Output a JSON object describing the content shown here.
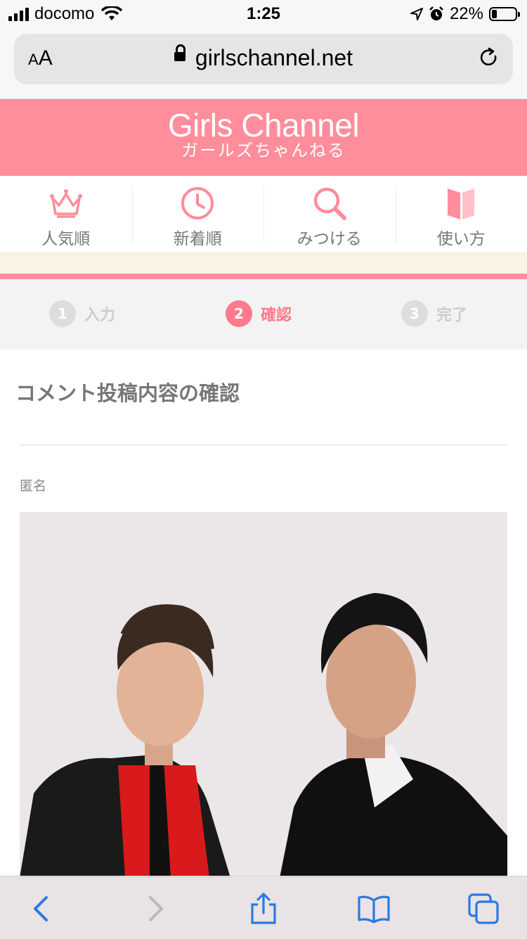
{
  "status_bar": {
    "carrier": "docomo",
    "time": "1:25",
    "battery_text": "22%",
    "battery_level": 0.22
  },
  "browser": {
    "text_size_button": "AA",
    "url": "girlschannel.net",
    "lock_icon": "lock-icon",
    "reload_icon": "reload-icon"
  },
  "site": {
    "title": "Girls Channel",
    "subtitle": "ガールズちゃんねる",
    "brand_color": "#ff8d9b"
  },
  "nav": {
    "items": [
      {
        "label": "人気順",
        "icon": "crown-icon"
      },
      {
        "label": "新着順",
        "icon": "clock-icon"
      },
      {
        "label": "みつける",
        "icon": "search-icon"
      },
      {
        "label": "使い方",
        "icon": "book-icon"
      }
    ]
  },
  "steps": [
    {
      "num": "1",
      "label": "入力",
      "active": false
    },
    {
      "num": "2",
      "label": "確認",
      "active": true
    },
    {
      "num": "3",
      "label": "完了",
      "active": false
    }
  ],
  "content": {
    "title": "コメント投稿内容の確認",
    "author": "匿名"
  },
  "toolbar": {
    "icons": [
      "back-icon",
      "forward-icon",
      "share-icon",
      "bookmarks-icon",
      "tabs-icon"
    ]
  }
}
